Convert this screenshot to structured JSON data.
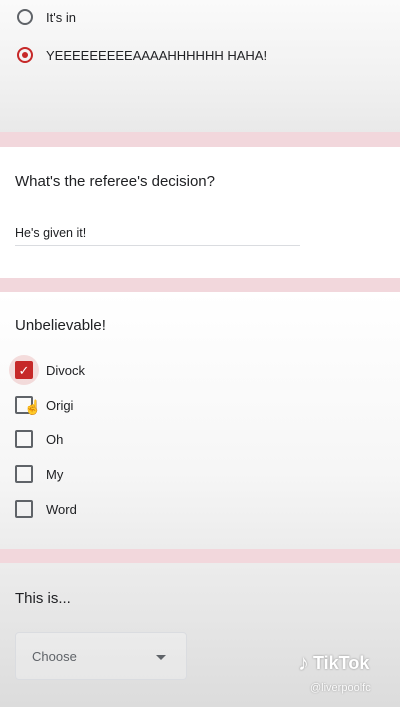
{
  "section1": {
    "options": [
      {
        "label": "It's in",
        "selected": false
      },
      {
        "label": "YEEEEEEEEEAAAAHHHHHH HAHA!",
        "selected": true
      }
    ]
  },
  "section2": {
    "question": "What's the referee's decision?",
    "answer": "He's given it!"
  },
  "section3": {
    "question": "Unbelievable!",
    "checkboxes": [
      {
        "label": "Divock",
        "checked": true
      },
      {
        "label": "Origi",
        "checked": false
      },
      {
        "label": "Oh",
        "checked": false
      },
      {
        "label": "My",
        "checked": false
      },
      {
        "label": "Word",
        "checked": false
      }
    ]
  },
  "section4": {
    "question": "This is...",
    "select_placeholder": "Choose"
  },
  "watermark": {
    "brand": "TikTok",
    "handle": "@liverpoolfc"
  },
  "colors": {
    "accent": "#c62828",
    "divider": "#f2d7dc"
  }
}
